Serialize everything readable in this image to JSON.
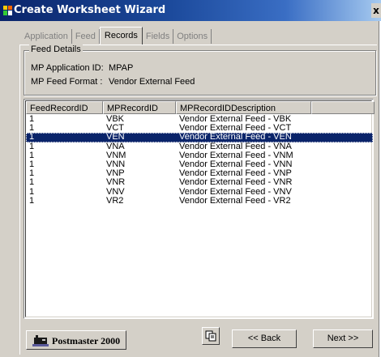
{
  "window": {
    "title": "Create Worksheet Wizard",
    "close_label": "x"
  },
  "tabs": [
    {
      "label": "Application",
      "active": false
    },
    {
      "label": "Feed",
      "active": false
    },
    {
      "label": "Records",
      "active": true
    },
    {
      "label": "Fields",
      "active": false
    },
    {
      "label": "Options",
      "active": false
    }
  ],
  "feed_details": {
    "legend": "Feed Details",
    "app_id_label": "MP Application ID:",
    "app_id_value": "MPAP",
    "format_label": "MP Feed Format :",
    "format_value": "Vendor External Feed"
  },
  "table": {
    "columns": [
      "FeedRecordID",
      "MPRecordID",
      "MPRecordIDDescription",
      ""
    ],
    "rows": [
      [
        "1",
        "VBK",
        "Vendor External Feed - VBK"
      ],
      [
        "1",
        "VCT",
        "Vendor External Feed - VCT"
      ],
      [
        "1",
        "VEN",
        "Vendor External Feed - VEN"
      ],
      [
        "1",
        "VNA",
        "Vendor External Feed - VNA"
      ],
      [
        "1",
        "VNM",
        "Vendor External Feed - VNM"
      ],
      [
        "1",
        "VNN",
        "Vendor External Feed - VNN"
      ],
      [
        "1",
        "VNP",
        "Vendor External Feed - VNP"
      ],
      [
        "1",
        "VNR",
        "Vendor External Feed - VNR"
      ],
      [
        "1",
        "VNV",
        "Vendor External Feed - VNV"
      ],
      [
        "1",
        "VR2",
        "Vendor External Feed - VR2"
      ]
    ],
    "selected_index": 2
  },
  "footer": {
    "logo_text": "Postmaster 2000",
    "copy_icon": "copy-icon",
    "back_label": "<< Back",
    "next_label": "Next >>"
  },
  "colors": {
    "selection": "#0a246a",
    "face": "#d4d0c8",
    "title_start": "#0a246a",
    "title_end": "#a6caf0"
  }
}
